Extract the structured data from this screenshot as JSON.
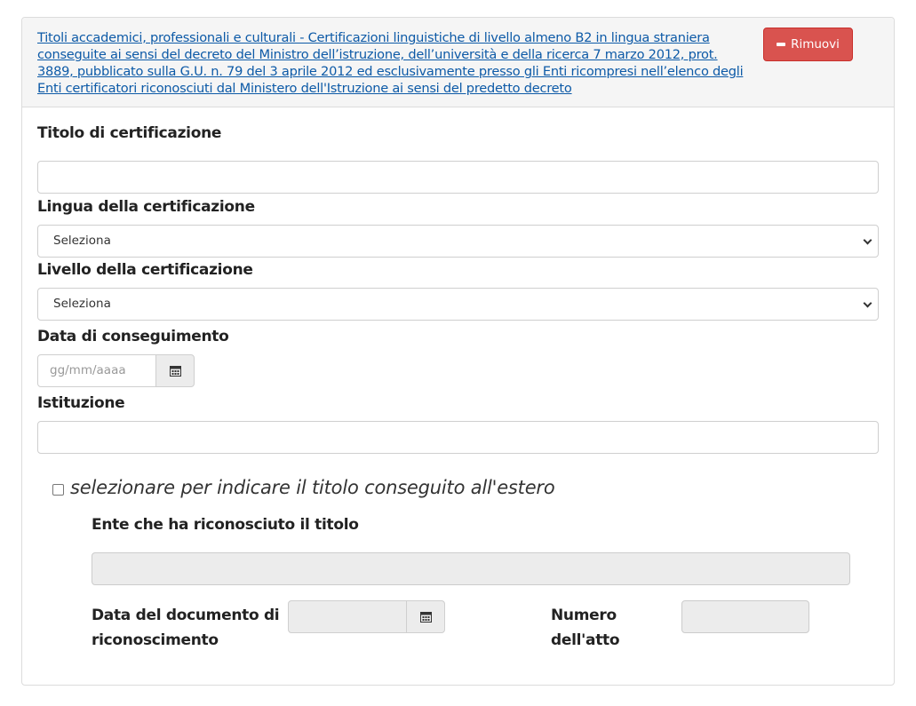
{
  "header": {
    "title": "Titoli accademici, professionali e culturali - Certificazioni linguistiche di livello almeno B2 in lingua straniera conseguite ai sensi del decreto del Ministro dell’istruzione, dell’università e della ricerca 7 marzo 2012, prot. 3889, pubblicato sulla G.U. n. 79 del 3 aprile 2012 ed esclusivamente presso gli Enti ricompresi nell’elenco degli Enti certificatori riconosciuti dal Ministero dell'Istruzione ai sensi del predetto decreto",
    "remove_label": "Rimuovi"
  },
  "form": {
    "titolo_label": "Titolo di certificazione",
    "titolo_value": "",
    "lingua_label": "Lingua della certificazione",
    "lingua_value": "Seleziona",
    "livello_label": "Livello della certificazione",
    "livello_value": "Seleziona",
    "data_label": "Data di conseguimento",
    "data_placeholder": "gg/mm/aaaa",
    "istituzione_label": "Istituzione",
    "istituzione_value": ""
  },
  "estero": {
    "checkbox_label": "selezionare per indicare il titolo conseguito all'estero",
    "checked": false,
    "ente_label": "Ente che ha riconosciuto il titolo",
    "data_doc_label_line1": "Data del documento di",
    "data_doc_label_line2": "riconoscimento",
    "numero_label_line1": "Numero",
    "numero_label_line2": "dell'atto"
  },
  "colors": {
    "link": "#0d5aa7",
    "remove_button": "#d9534f"
  },
  "icons": [
    "minus-icon",
    "calendar-icon",
    "chevron-down-icon"
  ]
}
